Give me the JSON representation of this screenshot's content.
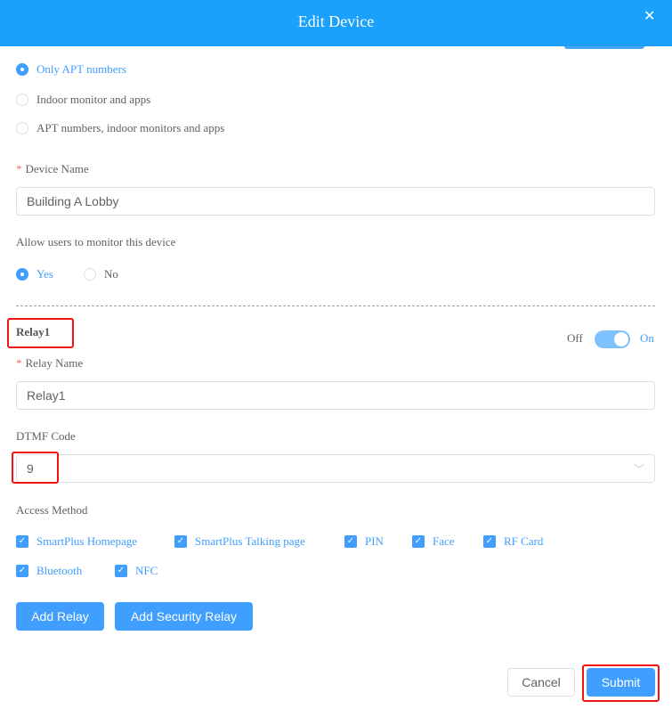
{
  "dialog": {
    "title": "Edit Device",
    "close_icon": "close-icon"
  },
  "call_options": [
    {
      "label": "Only APT numbers",
      "selected": true
    },
    {
      "label": "Indoor monitor and apps",
      "selected": false
    },
    {
      "label": "APT numbers, indoor monitors and apps",
      "selected": false
    }
  ],
  "device_name": {
    "label": "Device Name",
    "value": "Building A Lobby"
  },
  "monitor": {
    "label": "Allow users to monitor this device",
    "yes": "Yes",
    "no": "No",
    "selected": "Yes"
  },
  "relay": {
    "title": "Relay1",
    "toggle_off": "Off",
    "toggle_on": "On",
    "enabled": true,
    "name_label": "Relay Name",
    "name_value": "Relay1",
    "dtmf_label": "DTMF Code",
    "dtmf_value": "9",
    "access_label": "Access Method",
    "access_methods": [
      {
        "label": "SmartPlus Homepage",
        "checked": true
      },
      {
        "label": "SmartPlus Talking page",
        "checked": true
      },
      {
        "label": "PIN",
        "checked": true
      },
      {
        "label": "Face",
        "checked": true
      },
      {
        "label": "RF Card",
        "checked": true
      },
      {
        "label": "Bluetooth",
        "checked": true
      },
      {
        "label": "NFC",
        "checked": true
      }
    ]
  },
  "buttons": {
    "add_relay": "Add Relay",
    "add_security_relay": "Add Security Relay",
    "cancel": "Cancel",
    "submit": "Submit"
  },
  "colors": {
    "header": "#1ba1fb",
    "primary": "#409eff",
    "highlight": "#f31212"
  }
}
